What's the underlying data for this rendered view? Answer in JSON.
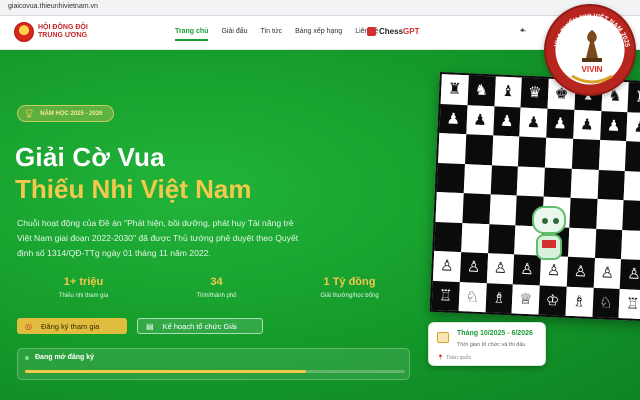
{
  "browser": {
    "url": "giaicovua.thieunhivietnam.vn"
  },
  "header": {
    "org_name": "HỘI ĐỒNG ĐỘI TRUNG ƯƠNG",
    "nav": [
      {
        "label": "Trang chủ",
        "active": true
      },
      {
        "label": "Giải đấu",
        "active": false
      },
      {
        "label": "Tin tức",
        "active": false
      },
      {
        "label": "Bảng xếp hạng",
        "active": false
      },
      {
        "label": "Liên hệ",
        "active": false
      }
    ],
    "chessgpt_prefix": "Chess",
    "chessgpt_suffix": "GPT",
    "right_icon": "translate-icon"
  },
  "hero": {
    "badge": "NĂM HỌC 2025 - 2026",
    "title_line1": "Giải Cờ Vua",
    "title_line2": "Thiếu Nhi Việt Nam",
    "description": "Chuỗi hoạt động của Đề án \"Phát hiện, bồi dưỡng, phát huy Tài năng trẻ Việt Nam giai đoạn 2022-2030\" đã được Thủ tướng phê duyệt theo Quyết định số 1314/QĐ-TTg ngày 01 tháng 11 năm 2022.",
    "stats": [
      {
        "value": "1+ triệu",
        "label": "Thiếu nhi tham gia"
      },
      {
        "value": "34",
        "label": "Tỉnh/thành phố"
      },
      {
        "value": "1 Tỷ đồng",
        "label": "Giải thưởng/học bổng"
      }
    ],
    "register_button": "Đăng ký tham gia",
    "plan_button": "Kế hoạch tổ chức Giải",
    "registration_status": "Đang mở đăng ký",
    "registration_progress": 0.74
  },
  "callout": {
    "dates": "Tháng 10/2025 - 6/2026",
    "subtitle": "Thời gian tổ chức và thi đấu",
    "location": "Toàn quốc"
  },
  "seal": {
    "top_text": "VUA THIẾU NHI VIỆT NAM 2025",
    "center_text": "VIVIN"
  },
  "colors": {
    "brand_green": "#16a22c",
    "accent_gold": "#f3c94b",
    "brand_red": "#c62828"
  },
  "board": {
    "pieces": [
      "♜♞♝♛♚♝♞♜",
      "♟♟♟♟♟♟♟♟",
      "        ",
      "        ",
      "        ",
      "        ",
      "♙♙♙♙♙♙♙♙",
      "♖♘♗♕♔♗♘♖"
    ]
  }
}
